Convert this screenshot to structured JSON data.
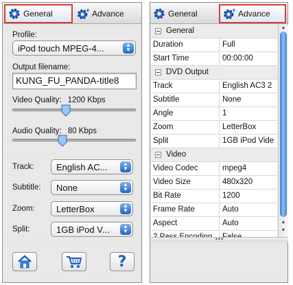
{
  "left": {
    "tabs": {
      "general": "General",
      "advance": "Advance"
    },
    "profile": {
      "label": "Profile:",
      "value": "iPod touch MPEG-4..."
    },
    "output": {
      "label": "Output filename:",
      "value": "KUNG_FU_PANDA-title8"
    },
    "video_quality": {
      "label": "Video Quality:",
      "value_text": "1200 Kbps",
      "level": 0.43
    },
    "audio_quality": {
      "label": "Audio Quality:",
      "value_text": "80 Kbps",
      "level": 0.4
    },
    "track": {
      "label": "Track:",
      "value": "English AC..."
    },
    "subtitle": {
      "label": "Subtitle:",
      "value": "None"
    },
    "zoom": {
      "label": "Zoom:",
      "value": "LetterBox"
    },
    "split": {
      "label": "Split:",
      "value": "1GB iPod V..."
    },
    "buttons": {
      "home": "home-icon",
      "cart": "cart-icon",
      "help": "?"
    }
  },
  "right": {
    "tabs": {
      "general": "General",
      "advance": "Advance"
    },
    "grid": [
      {
        "category": "General"
      },
      {
        "key": "Duration",
        "value": "Full"
      },
      {
        "key": "Start Time",
        "value": "00:00:00"
      },
      {
        "category": "DVD Output"
      },
      {
        "key": "Track",
        "value": "English AC3 2"
      },
      {
        "key": "Subtitle",
        "value": "None"
      },
      {
        "key": "Angle",
        "value": "1"
      },
      {
        "key": "Zoom",
        "value": "LetterBox"
      },
      {
        "key": "Split",
        "value": "1GB iPod Vide"
      },
      {
        "category": "Video"
      },
      {
        "key": "Video Codec",
        "value": "mpeg4"
      },
      {
        "key": "Video Size",
        "value": "480x320"
      },
      {
        "key": "Bit Rate",
        "value": "1200"
      },
      {
        "key": "Frame Rate",
        "value": "Auto"
      },
      {
        "key": "Aspect",
        "value": "Auto"
      },
      {
        "key": "2 Pass Encoding",
        "value": "False"
      }
    ],
    "splitter_text": "•••"
  },
  "colors": {
    "active_tab_border": "#d63a3a",
    "accent_blue": "#2563c4"
  }
}
